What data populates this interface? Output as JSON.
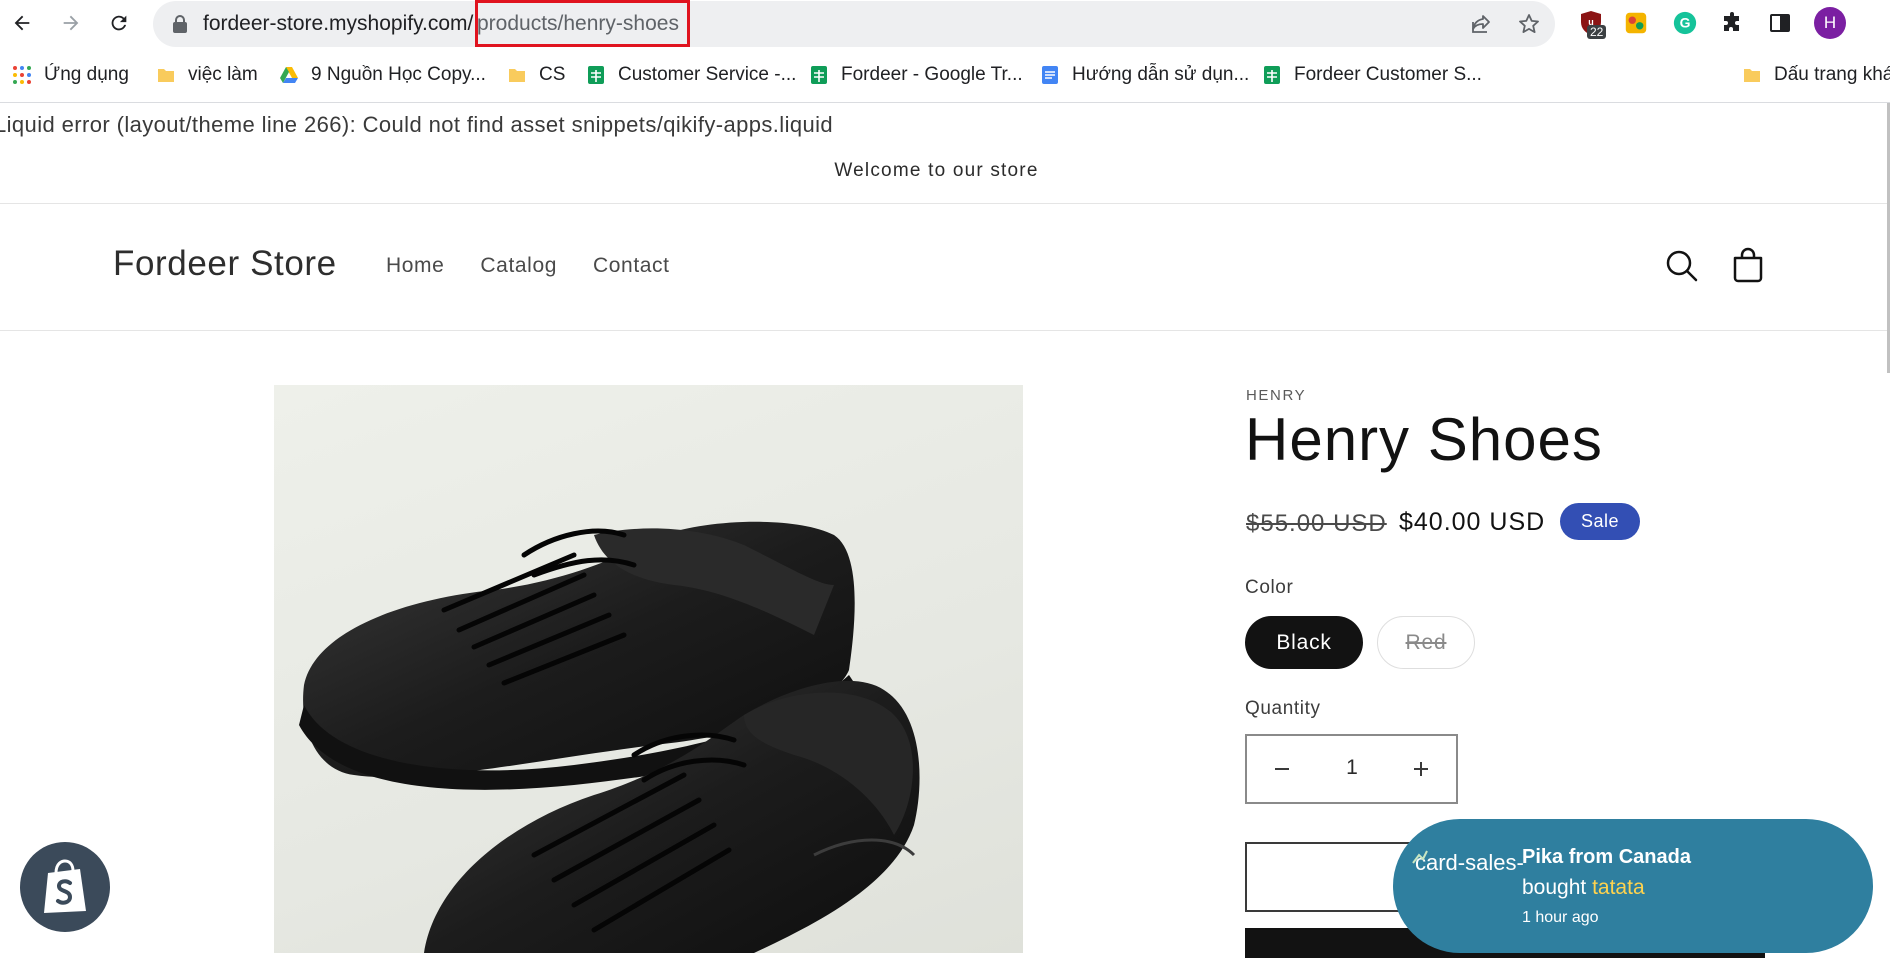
{
  "browser": {
    "url_host": "fordeer-store.myshopify.com/",
    "url_path": "products/henry-shoes",
    "extension_badge": "22",
    "profile_initial": "H",
    "bookmarks": [
      {
        "label": "Ứng dụng",
        "icon": "apps-grid-icon"
      },
      {
        "label": "việc làm",
        "icon": "folder-icon"
      },
      {
        "label": "9 Nguồn Học Copy...",
        "icon": "google-drive-icon"
      },
      {
        "label": "CS",
        "icon": "folder-icon"
      },
      {
        "label": "Customer Service -...",
        "icon": "google-sheets-icon"
      },
      {
        "label": "Fordeer - Google Tr...",
        "icon": "google-sheets-icon"
      },
      {
        "label": "Hướng dẫn sử dụn...",
        "icon": "google-docs-icon"
      },
      {
        "label": "Fordeer Customer S...",
        "icon": "google-sheets-icon"
      }
    ],
    "other_bookmarks": "Dấu trang khác"
  },
  "page": {
    "liquid_error": "Liquid error (layout/theme line 266): Could not find asset snippets/qikify-apps.liquid",
    "announcement": "Welcome to our store",
    "store_name": "Fordeer Store",
    "nav": [
      "Home",
      "Catalog",
      "Contact"
    ]
  },
  "product": {
    "vendor": "HENRY",
    "title": "Henry Shoes",
    "price_compare": "$55.00 USD",
    "price": "$40.00 USD",
    "badge": "Sale",
    "color_label": "Color",
    "colors": [
      {
        "label": "Black",
        "selected": true
      },
      {
        "label": "Red",
        "available": false
      }
    ],
    "quantity_label": "Quantity",
    "quantity": "1"
  },
  "sales_pop": {
    "broken_image_alt": "card-sales-",
    "name": "Pika from Canada",
    "action": "bought",
    "product": "tatata",
    "time": "1 hour ago"
  },
  "colors": {
    "sale_badge": "#334fb4",
    "sales_pop_bg": "#2f7f9f",
    "highlight_box": "#e0131f"
  }
}
